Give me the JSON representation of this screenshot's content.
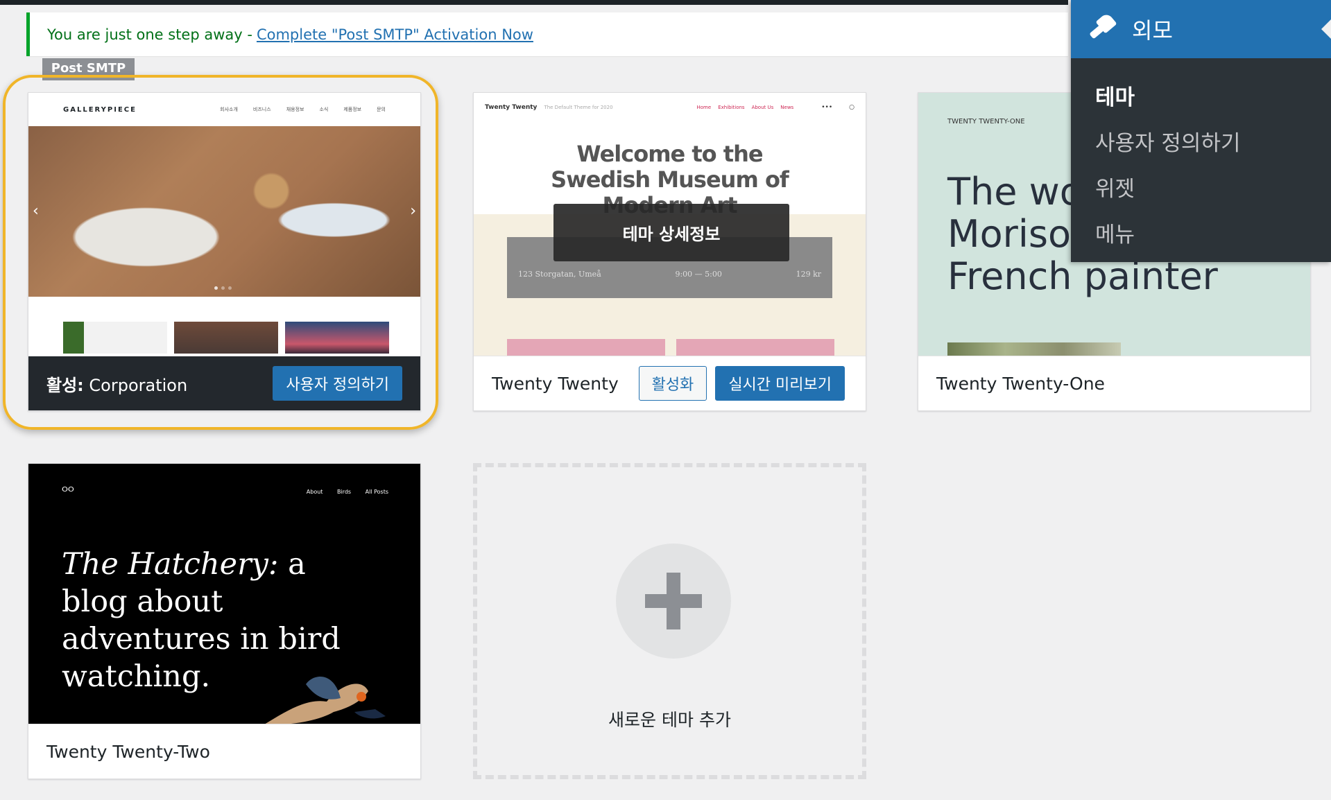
{
  "notice": {
    "text": "You are just one step away - ",
    "link": "Complete \"Post SMTP\" Activation Now",
    "tab": "Post SMTP"
  },
  "themes": {
    "active": {
      "shot_brand": "GALLERYPIECE",
      "shot_nav": [
        "회사소개",
        "비즈니스",
        "채용정보",
        "소식",
        "제품정보",
        "문의"
      ],
      "active_prefix": "활성:",
      "name": "Corporation",
      "customize": "사용자 정의하기"
    },
    "twenty_twenty": {
      "shot_site": "Twenty Twenty",
      "shot_tagline": "The Default Theme for 2020",
      "shot_nav": [
        "Home",
        "Exhibitions",
        "About Us",
        "News"
      ],
      "shot_title": "Welcome to the Swedish Museum of Modern Art",
      "shot_address": "123 Storgatan, Umeå",
      "shot_hours": "9:00 — 5:00",
      "shot_price": "129 kr",
      "details_overlay": "테마 상세정보",
      "name": "Twenty Twenty",
      "activate": "활성화",
      "live_preview": "실시간 미리보기"
    },
    "twenty_twenty_one": {
      "shot_small": "TWENTY TWENTY-ONE",
      "shot_title": "The wo\nMorisot\nFrench painter",
      "name": "Twenty Twenty-One"
    },
    "twenty_twenty_two": {
      "shot_logo": "ᴼᴼ",
      "shot_nav": [
        "About",
        "Birds",
        "All Posts"
      ],
      "shot_title_italic": "The Hatchery:",
      "shot_title_rest": " a blog about adventures in bird watching.",
      "name": "Twenty Twenty-Two"
    },
    "add_new": {
      "label": "새로운 테마 추가"
    }
  },
  "flyout": {
    "title": "외모",
    "items": [
      {
        "label": "테마",
        "current": true
      },
      {
        "label": "사용자 정의하기",
        "current": false
      },
      {
        "label": "위젯",
        "current": false
      },
      {
        "label": "메뉴",
        "current": false
      }
    ]
  },
  "colors": {
    "accent": "#2271b1",
    "highlight_ring": "#f0b529",
    "notice_border": "#00a32a",
    "menu_bg": "#2c3338"
  }
}
